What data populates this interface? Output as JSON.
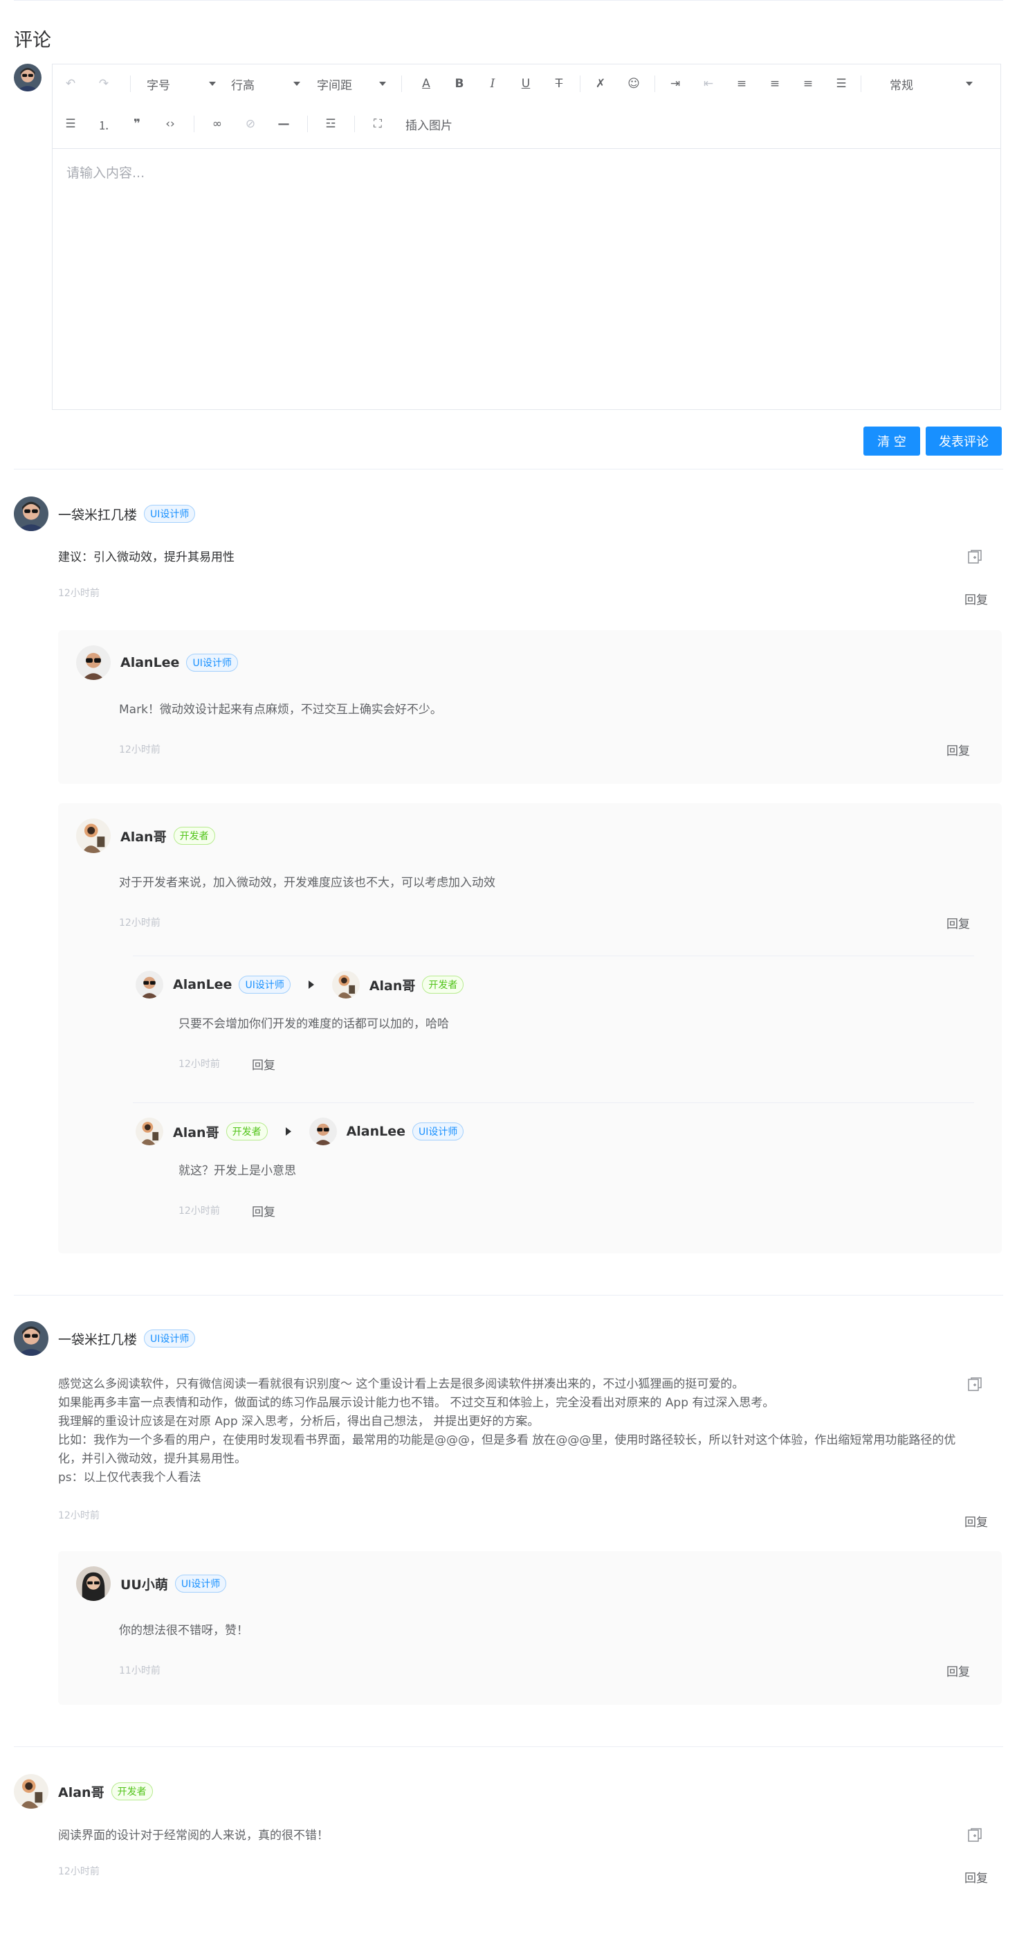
{
  "page_title": "评论",
  "editor": {
    "font_size_label": "字号",
    "line_height_label": "行高",
    "letter_spacing_label": "字间距",
    "style_select": "常规",
    "insert_image_label": "插入图片",
    "placeholder": "请输入内容..."
  },
  "actions": {
    "clear_label": "清 空",
    "submit_label": "发表评论"
  },
  "tags": {
    "ui": "UI设计师",
    "dev": "开发者"
  },
  "reply_label": "回复",
  "comments": [
    {
      "user": "一袋米扛几楼",
      "role": "UI设计师",
      "text": "建议：引入微动效，提升其易用性",
      "time": "12小时前",
      "replies": [
        {
          "user": "AlanLee",
          "role": "UI设计师",
          "text": "Mark！微动效设计起来有点麻烦，不过交互上确实会好不少。",
          "time": "12小时前"
        },
        {
          "user": "Alan哥",
          "role": "开发者",
          "text": "对于开发者来说，加入微动效，开发难度应该也不大，可以考虑加入动效",
          "time": "12小时前",
          "subreplies": [
            {
              "from": "AlanLee",
              "from_role": "UI设计师",
              "to": "Alan哥",
              "to_role": "开发者",
              "text": "只要不会增加你们开发的难度的话都可以加的，哈哈",
              "time": "12小时前"
            },
            {
              "from": "Alan哥",
              "from_role": "开发者",
              "to": "AlanLee",
              "to_role": "UI设计师",
              "text": "就这？开发上是小意思",
              "time": "12小时前"
            }
          ]
        }
      ]
    },
    {
      "user": "一袋米扛几楼",
      "role": "UI设计师",
      "lines": [
        "感觉这么多阅读软件，只有微信阅读一看就很有识别度～ 这个重设计看上去是很多阅读软件拼凑出来的，不过小狐狸画的挺可爱的。",
        "如果能再多丰富一点表情和动作，做面试的练习作品展示设计能力也不错。 不过交互和体验上，完全没看出对原来的 App 有过深入思考。",
        "我理解的重设计应该是在对原 App 深入思考，分析后，得出自己想法， 并提出更好的方案。",
        "比如：我作为一个多看的用户，在使用时发现看书界面，最常用的功能是@@@，但是多看 放在@@@里，使用时路径较长，所以针对这个体验，作出缩短常用功能路径的优",
        "化，并引入微动效，提升其易用性。",
        "ps：以上仅代表我个人看法"
      ],
      "time": "12小时前",
      "replies": [
        {
          "user": "UU小萌",
          "role": "UI设计师",
          "text": "你的想法很不错呀，赞！",
          "time": "11小时前"
        }
      ]
    },
    {
      "user": "Alan哥",
      "role": "开发者",
      "text": "阅读界面的设计对于经常阅的人来说，真的很不错！",
      "time": "12小时前"
    }
  ]
}
